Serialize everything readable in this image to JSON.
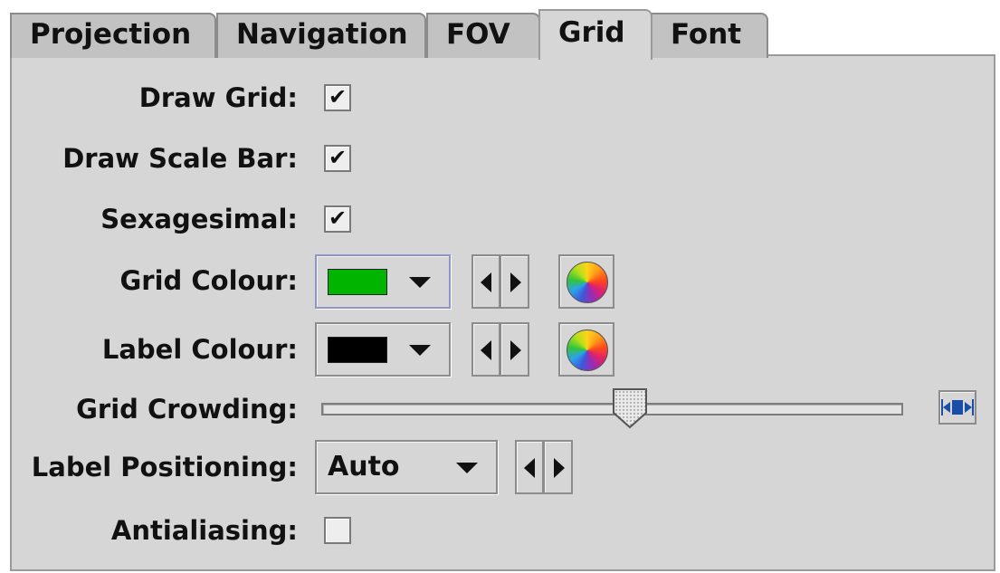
{
  "tabs": [
    {
      "label": "Projection",
      "active": false
    },
    {
      "label": "Navigation",
      "active": false
    },
    {
      "label": "FOV",
      "active": false
    },
    {
      "label": "Grid",
      "active": true
    },
    {
      "label": "Font",
      "active": false
    }
  ],
  "fields": {
    "draw_grid": {
      "label": "Draw Grid:",
      "checked": true
    },
    "draw_scale_bar": {
      "label": "Draw Scale Bar:",
      "checked": true
    },
    "sexagesimal": {
      "label": "Sexagesimal:",
      "checked": true
    },
    "grid_colour": {
      "label": "Grid Colour:",
      "color": "#00b400"
    },
    "label_colour": {
      "label": "Label Colour:",
      "color": "#000000"
    },
    "grid_crowding": {
      "label": "Grid Crowding:",
      "level": 0.53
    },
    "label_positioning": {
      "label": "Label Positioning:",
      "value": "Auto"
    },
    "antialiasing": {
      "label": "Antialiasing:",
      "checked": false
    }
  },
  "glyphs": {
    "check": "✔"
  }
}
